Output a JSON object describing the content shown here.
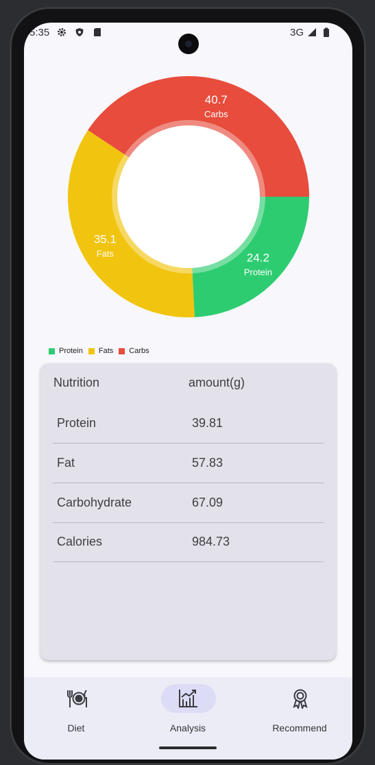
{
  "status_bar": {
    "time": "5:35",
    "network": "3G",
    "icons": [
      "gear-icon",
      "shield-icon",
      "sd-card-icon",
      "signal-icon",
      "battery-icon"
    ]
  },
  "chart_data": {
    "type": "pie",
    "donut": true,
    "categories": [
      "Protein",
      "Fats",
      "Carbs"
    ],
    "values": [
      24.2,
      35.1,
      40.7
    ],
    "colors": [
      "#2ecc71",
      "#f1c40f",
      "#e74c3c"
    ],
    "labels": [
      {
        "value": "24.2",
        "name": "Protein"
      },
      {
        "value": "35.1",
        "name": "Fats"
      },
      {
        "value": "40.7",
        "name": "Carbs"
      }
    ],
    "legend": "bottom-left"
  },
  "legend": [
    {
      "label": "Protein",
      "color": "#2ecc71"
    },
    {
      "label": "Fats",
      "color": "#f1c40f"
    },
    {
      "label": "Carbs",
      "color": "#e74c3c"
    }
  ],
  "table": {
    "headers": [
      "Nutrition",
      "amount(g)"
    ],
    "rows": [
      [
        "Protein",
        "39.81"
      ],
      [
        "Fat",
        "57.83"
      ],
      [
        "Carbohydrate",
        "67.09"
      ],
      [
        "Calories",
        "984.73"
      ]
    ]
  },
  "bottom_nav": {
    "items": [
      {
        "label": "Diet",
        "icon": "plate-icon",
        "active": false
      },
      {
        "label": "Analysis",
        "icon": "chart-icon",
        "active": true
      },
      {
        "label": "Recommend",
        "icon": "award-icon",
        "active": false
      }
    ]
  }
}
